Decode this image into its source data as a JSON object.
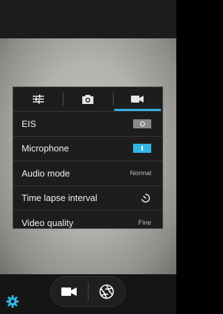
{
  "tabs": [
    {
      "icon": "sliders-icon",
      "active": false
    },
    {
      "icon": "camera-icon",
      "active": false
    },
    {
      "icon": "video-camera-icon",
      "active": true
    }
  ],
  "settings": {
    "eis": {
      "label": "EIS",
      "state": "off"
    },
    "microphone": {
      "label": "Microphone",
      "state": "on"
    },
    "audio_mode": {
      "label": "Audio mode",
      "value": "Normal"
    },
    "time_lapse": {
      "label": "Time lapse interval",
      "icon": "timer-icon"
    },
    "video_quality": {
      "label": "Video quality",
      "value": "Fine"
    }
  },
  "controls": {
    "mode_icon": "video-camera-icon",
    "shutter_icon": "shutter-icon",
    "settings_icon": "gear-icon"
  },
  "colors": {
    "accent": "#33b5e5",
    "panel_bg": "#1d1d1d",
    "toggle_off": "#8a8a8a"
  }
}
